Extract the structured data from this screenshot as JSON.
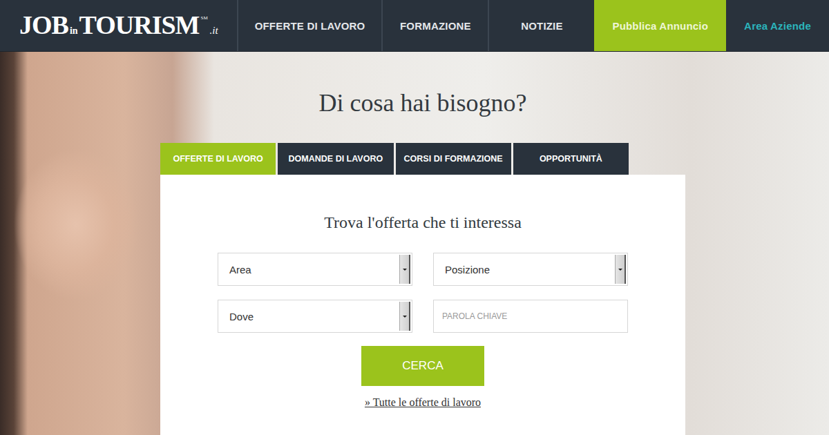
{
  "logo": {
    "first": "JOB",
    "middle": "in",
    "last": "TOURISM",
    "mark": "SM",
    "suffix": ".it"
  },
  "nav": [
    {
      "label": "OFFERTE DI LAVORO",
      "kind": "link"
    },
    {
      "label": "FORMAZIONE",
      "kind": "link"
    },
    {
      "label": "NOTIZIE",
      "kind": "link"
    },
    {
      "label": "Pubblica Annuncio",
      "kind": "highlight"
    },
    {
      "label": "Area Aziende",
      "kind": "accent"
    }
  ],
  "hero": {
    "title": "Di cosa hai bisogno?"
  },
  "tabs": [
    {
      "label": "OFFERTE DI LAVORO",
      "selected": true
    },
    {
      "label": "DOMANDE DI LAVORO",
      "selected": false
    },
    {
      "label": "CORSI DI FORMAZIONE",
      "selected": false
    },
    {
      "label": "OPPORTUNITÀ",
      "selected": false
    }
  ],
  "search": {
    "title": "Trova l'offerta che ti interessa",
    "fields": [
      {
        "kind": "select",
        "label": "Area"
      },
      {
        "kind": "select",
        "label": "Posizione"
      },
      {
        "kind": "select",
        "label": "Dove"
      },
      {
        "kind": "input",
        "label": "PAROLA CHIAVE"
      }
    ],
    "button": "CERCA",
    "link": "» Tutte le offerte di lavoro"
  }
}
